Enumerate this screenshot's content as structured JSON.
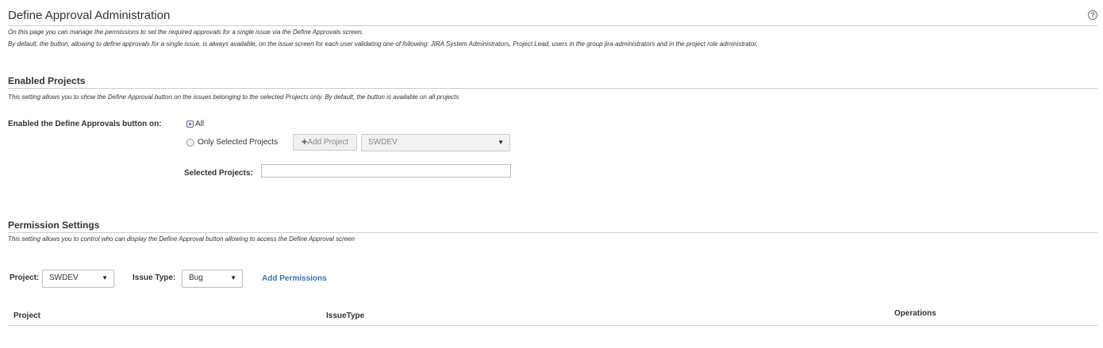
{
  "header": {
    "title": "Define Approval Administration",
    "help_icon": "?",
    "description_1": "On this page you can manage the permissions to set the required approvals for a single issue via the Define Approvals screen.",
    "description_2": "By default, the button, allowing to define approvals for a single issue, is always available, on the issue screen for each user validating one of following: JIRA System Administrators, Project Lead, users in the group jira-administrators and in the project role administrator."
  },
  "enabled_projects": {
    "title": "Enabled Projects",
    "description": "This setting allows you to show the Define Approval button on the issues belonging to the selected Projects only. By default, the button is available on all projects",
    "enabled_label": "Enabled the Define Approvals button on:",
    "option_all": "All",
    "option_all_checked": true,
    "option_selected": "Only Selected Projects",
    "add_project_icon": "plus-icon",
    "add_project_plus": "✚",
    "add_project_label": "Add Project",
    "project_select_value": "SWDEV",
    "selected_projects_label": "Selected Projects:",
    "selected_projects_value": ""
  },
  "permission_settings": {
    "title": "Permission Settings",
    "description": "This setting allows you to control who can display the Define Approval button allowing to access the Define Approval screen",
    "project_label": "Project:",
    "project_value": "SWDEV",
    "issue_type_label": "Issue Type:",
    "issue_type_value": "Bug",
    "add_permissions_link": "Add Permissions",
    "dropdown_arrow": "▼",
    "table_headers": [
      "Project",
      "IssueType",
      "Operations"
    ]
  },
  "colors": {
    "link": "#3b73af",
    "rule": "#cccccc",
    "text": "#333333"
  }
}
